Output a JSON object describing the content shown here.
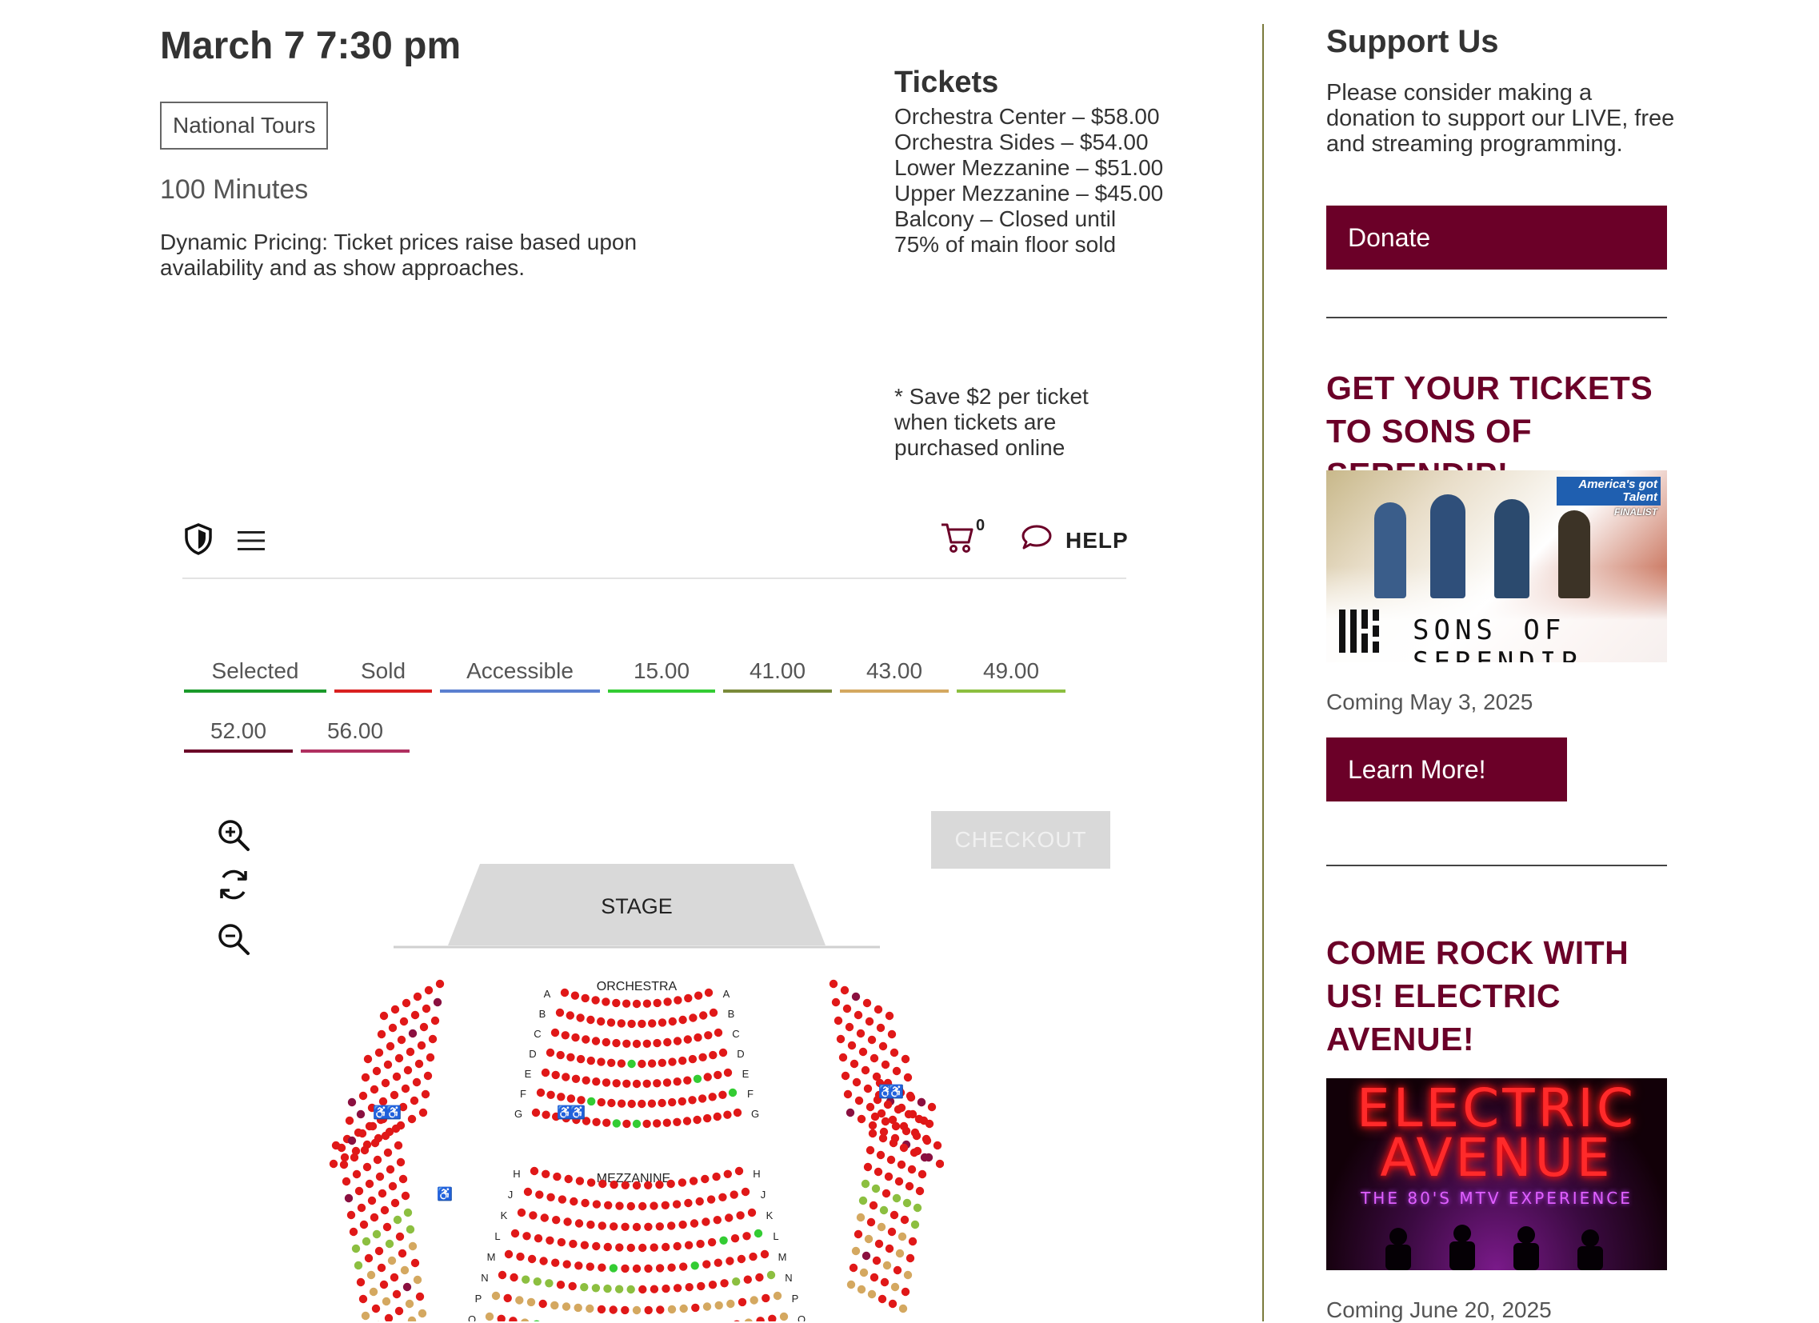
{
  "event": {
    "title": "March 7 7:30 pm",
    "tag": "National Tours",
    "duration": "100 Minutes",
    "pricing_note": "Dynamic Pricing: Ticket prices raise based upon availability and as show approaches."
  },
  "tickets": {
    "heading": "Tickets",
    "items": [
      "Orchestra Center – $58.00",
      "Orchestra Sides – $54.00",
      "Lower Mezzanine – $51.00",
      "Upper Mezzanine – $45.00",
      "Balcony – Closed until 75% of main floor sold"
    ],
    "save_note": "* Save $2 per ticket when tickets are purchased online"
  },
  "widget": {
    "cart_count": "0",
    "help_label": "HELP",
    "legend": [
      {
        "label": "Selected",
        "color": "#1a9a2a"
      },
      {
        "label": "Sold",
        "color": "#d92020"
      },
      {
        "label": "Accessible",
        "color": "#5a7fd0"
      },
      {
        "label": "15.00",
        "color": "#33cc33"
      },
      {
        "label": "41.00",
        "color": "#7a8a3a"
      },
      {
        "label": "43.00",
        "color": "#d4a860"
      },
      {
        "label": "49.00",
        "color": "#8cbf40"
      },
      {
        "label": "52.00",
        "color": "#6b0028"
      },
      {
        "label": "56.00",
        "color": "#b03060"
      }
    ],
    "checkout_label": "CHECKOUT",
    "stage_label": "STAGE",
    "orchestra_label": "ORCHESTRA",
    "mezzanine_label": "MEZZANINE",
    "rows_orchestra": [
      "A",
      "B",
      "C",
      "D",
      "E",
      "F",
      "G"
    ],
    "rows_mezzanine": [
      "H",
      "J",
      "K",
      "L",
      "M",
      "N",
      "P",
      "Q"
    ]
  },
  "sidebar": {
    "heading": "Support Us",
    "text": "Please consider making a donation to support our LIVE, free and streaming programming.",
    "donate_label": "Donate",
    "promos": [
      {
        "heading": "GET YOUR TICKETS TO SONS OF SERENDIP!",
        "image_text": "SONS OF SERENDIP",
        "badge_text": "America's got Talent",
        "badge_sub": "FINALIST",
        "coming": "Coming May 3, 2025",
        "button_label": "Learn More!"
      },
      {
        "heading": "COME ROCK WITH US! ELECTRIC AVENUE!",
        "image_line1": "ELECTRIC",
        "image_line2": "AVENUE",
        "image_line3": "THE 80'S MTV EXPERIENCE",
        "coming": "Coming June 20, 2025"
      }
    ]
  }
}
